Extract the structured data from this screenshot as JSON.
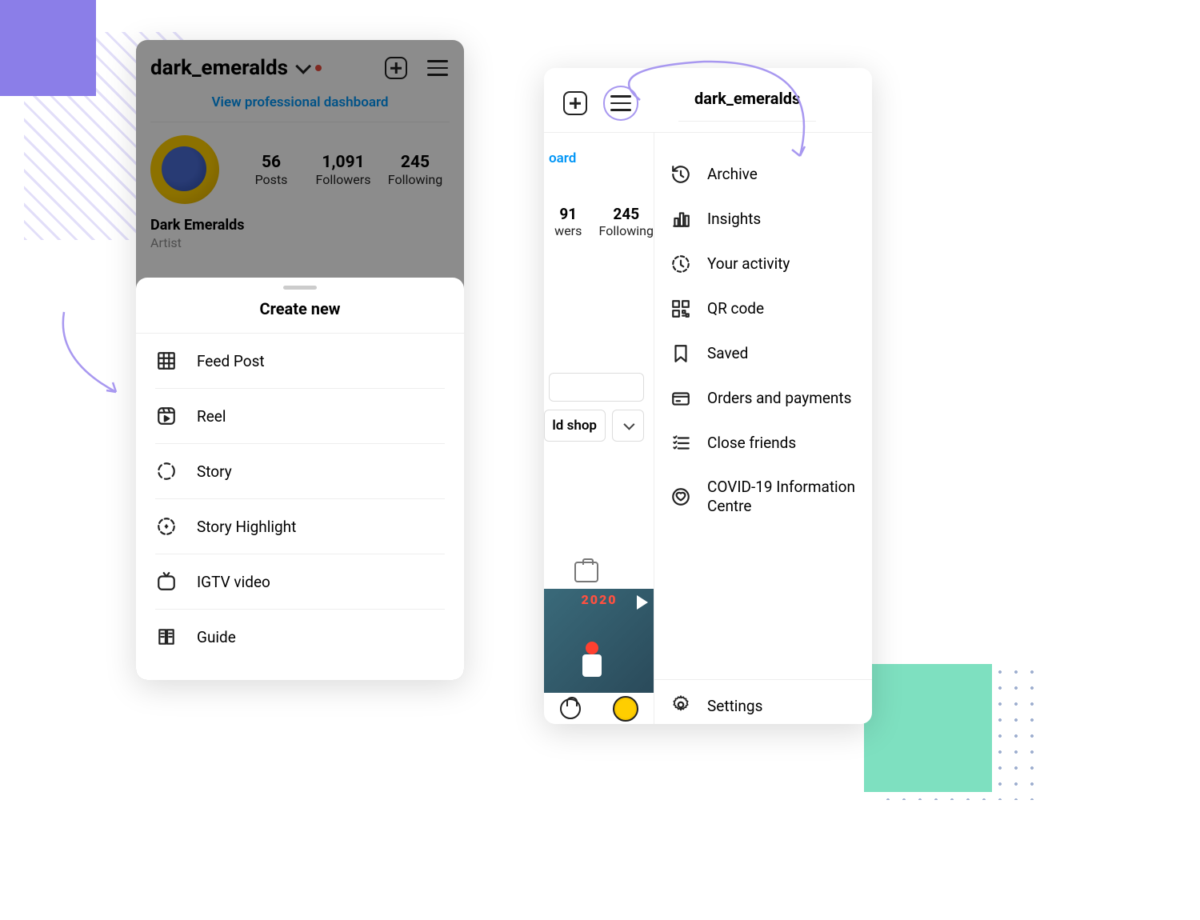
{
  "phone1": {
    "username": "dark_emeralds",
    "dashboard_link": "View professional dashboard",
    "stats": {
      "posts": {
        "count": "56",
        "label": "Posts"
      },
      "followers": {
        "count": "1,091",
        "label": "Followers"
      },
      "following": {
        "count": "245",
        "label": "Following"
      }
    },
    "display_name": "Dark Emeralds",
    "category": "Artist",
    "sheet": {
      "title": "Create new",
      "items": [
        {
          "label": "Feed Post"
        },
        {
          "label": "Reel"
        },
        {
          "label": "Story"
        },
        {
          "label": "Story Highlight"
        },
        {
          "label": "IGTV video"
        },
        {
          "label": "Guide"
        }
      ]
    }
  },
  "phone2": {
    "username": "dark_emeralds",
    "left": {
      "dashboard_fragment": "oard",
      "followers": {
        "count": "91",
        "label": "wers"
      },
      "following": {
        "count": "245",
        "label": "Following"
      },
      "shop_fragment": "ld shop",
      "year_overlay": "2020"
    },
    "menu": [
      {
        "label": "Archive"
      },
      {
        "label": "Insights"
      },
      {
        "label": "Your activity"
      },
      {
        "label": "QR code"
      },
      {
        "label": "Saved"
      },
      {
        "label": "Orders and payments"
      },
      {
        "label": "Close friends"
      },
      {
        "label": "COVID-19 Information Centre"
      }
    ],
    "settings_label": "Settings"
  }
}
